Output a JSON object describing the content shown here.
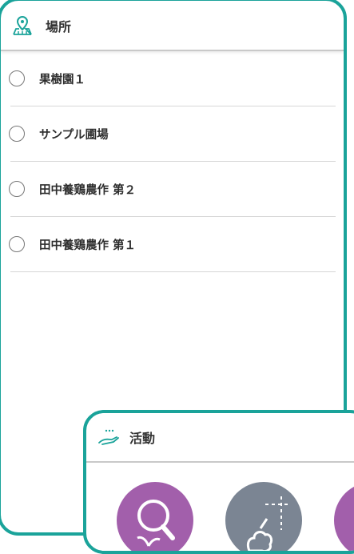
{
  "location_card": {
    "title": "場所",
    "icon": "map-pin-icon",
    "places": [
      {
        "label": "果樹園１",
        "selected": false
      },
      {
        "label": "サンプル圃場",
        "selected": false
      },
      {
        "label": "田中養鶏農作 第２",
        "selected": false
      },
      {
        "label": "田中養鶏農作 第１",
        "selected": false
      }
    ]
  },
  "activity_card": {
    "title": "活動",
    "icon": "hand-seedling-icon",
    "buttons": [
      {
        "icon": "magnifier-plant-icon",
        "color": "#a25fab"
      },
      {
        "icon": "tree-planting-icon",
        "color": "#7b8593"
      },
      {
        "icon": "activity-icon",
        "color": "#a25fab"
      }
    ]
  },
  "colors": {
    "accent": "#1aa39a"
  }
}
